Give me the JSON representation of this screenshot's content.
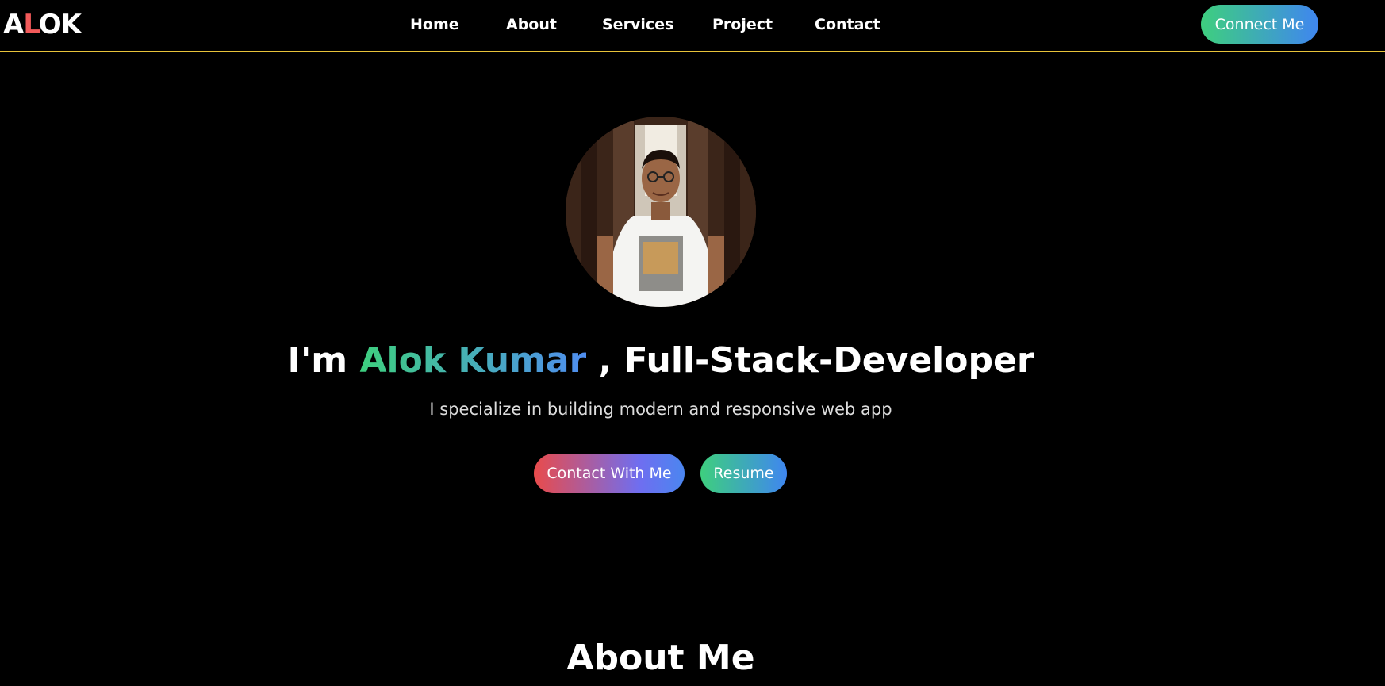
{
  "logo": {
    "first": "A",
    "accent": "L",
    "rest": "OK"
  },
  "nav": {
    "home": "Home",
    "about": "About",
    "services": "Services",
    "project": "Project",
    "contact": "Contact",
    "cta": "Connect Me"
  },
  "hero": {
    "prefix": "I'm ",
    "name": "Alok Kumar",
    "suffix": " , Full-Stack-Developer",
    "tagline": "I specialize in building modern and responsive web app",
    "contact_label": "Contact With Me",
    "resume_label": "Resume"
  },
  "about": {
    "title": "About Me"
  },
  "colors": {
    "background": "#000000",
    "nav_border": "#e8c33a",
    "logo_accent": "#f25a5a",
    "gradient_green": "#3ecf7e",
    "gradient_blue": "#3f86f0",
    "gradient_red": "#e94b4b"
  }
}
